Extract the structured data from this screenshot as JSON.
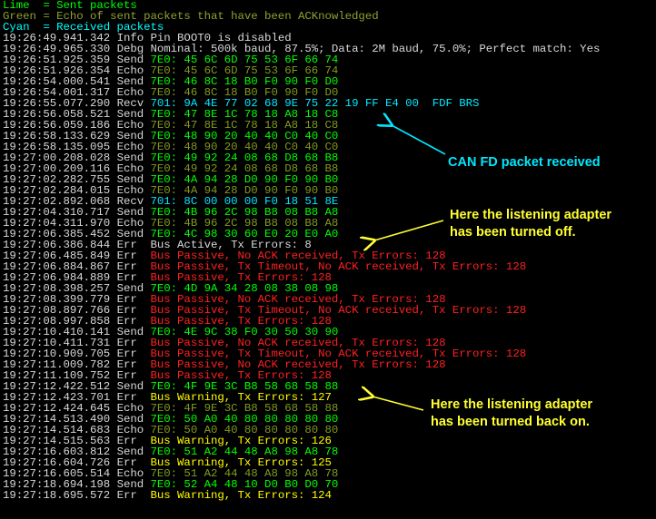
{
  "legend": [
    {
      "text": "Lime  = Sent packets",
      "style": "lime"
    },
    {
      "text": "Green = Echo of sent packets that have been ACKnowledged",
      "style": "green"
    },
    {
      "text": "Cyan  = Received packets",
      "style": "cyan"
    }
  ],
  "log": [
    {
      "time": "19:26:49.941.342",
      "type": "Info",
      "msg": "Pin BOOT0 is disabled",
      "style": "white"
    },
    {
      "time": "19:26:49.965.330",
      "type": "Debg",
      "msg": "Nominal: 500k baud, 87.5%; Data: 2M baud, 75.0%; Perfect match: Yes",
      "style": "white"
    },
    {
      "time": "19:26:51.925.359",
      "type": "Send",
      "msg": "7E0: 45 6C 6D 75 53 6F 66 74",
      "style": "send"
    },
    {
      "time": "19:26:51.926.354",
      "type": "Echo",
      "msg": "7E0: 45 6C 6D 75 53 6F 66 74",
      "style": "echo"
    },
    {
      "time": "19:26:54.000.541",
      "type": "Send",
      "msg": "7E0: 46 8C 18 B0 F0 90 F0 D0",
      "style": "send"
    },
    {
      "time": "19:26:54.001.317",
      "type": "Echo",
      "msg": "7E0: 46 8C 18 B0 F0 90 F0 D0",
      "style": "echo"
    },
    {
      "time": "19:26:55.077.290",
      "type": "Recv",
      "msg": "701: 9A 4E 77 02 68 9E 75 22 19 FF E4 00  FDF BRS",
      "style": "recv"
    },
    {
      "time": "19:26:56.058.521",
      "type": "Send",
      "msg": "7E0: 47 8E 1C 78 18 A8 18 C8",
      "style": "send"
    },
    {
      "time": "19:26:56.059.186",
      "type": "Echo",
      "msg": "7E0: 47 8E 1C 78 18 A8 18 C8",
      "style": "echo"
    },
    {
      "time": "19:26:58.133.629",
      "type": "Send",
      "msg": "7E0: 48 90 20 40 40 C0 40 C0",
      "style": "send"
    },
    {
      "time": "19:26:58.135.095",
      "type": "Echo",
      "msg": "7E0: 48 90 20 40 40 C0 40 C0",
      "style": "echo"
    },
    {
      "time": "19:27:00.208.028",
      "type": "Send",
      "msg": "7E0: 49 92 24 08 68 D8 68 B8",
      "style": "send"
    },
    {
      "time": "19:27:00.209.116",
      "type": "Echo",
      "msg": "7E0: 49 92 24 08 68 D8 68 B8",
      "style": "echo"
    },
    {
      "time": "19:27:02.282.755",
      "type": "Send",
      "msg": "7E0: 4A 94 28 D0 90 F0 90 B0",
      "style": "send"
    },
    {
      "time": "19:27:02.284.015",
      "type": "Echo",
      "msg": "7E0: 4A 94 28 D0 90 F0 90 B0",
      "style": "echo"
    },
    {
      "time": "19:27:02.892.068",
      "type": "Recv",
      "msg": "701: 8C 00 00 00 F0 18 51 8E",
      "style": "recv"
    },
    {
      "time": "19:27:04.310.717",
      "type": "Send",
      "msg": "7E0: 4B 96 2C 98 B8 08 B8 A8",
      "style": "send"
    },
    {
      "time": "19:27:04.311.970",
      "type": "Echo",
      "msg": "7E0: 4B 96 2C 98 B8 08 B8 A8",
      "style": "echo"
    },
    {
      "time": "19:27:06.385.452",
      "type": "Send",
      "msg": "7E0: 4C 98 30 60 E0 20 E0 A0",
      "style": "send"
    },
    {
      "time": "19:27:06.386.844",
      "type": "Err ",
      "msg": "Bus Active, Tx Errors: 8",
      "style": "normal"
    },
    {
      "time": "19:27:06.485.849",
      "type": "Err ",
      "msg": "Bus Passive, No ACK received, Tx Errors: 128",
      "style": "err"
    },
    {
      "time": "19:27:06.884.867",
      "type": "Err ",
      "msg": "Bus Passive, Tx Timeout, No ACK received, Tx Errors: 128",
      "style": "err"
    },
    {
      "time": "19:27:06.984.889",
      "type": "Err ",
      "msg": "Bus Passive, Tx Errors: 128",
      "style": "err"
    },
    {
      "time": "19:27:08.398.257",
      "type": "Send",
      "msg": "7E0: 4D 9A 34 28 08 38 08 98",
      "style": "send"
    },
    {
      "time": "19:27:08.399.779",
      "type": "Err ",
      "msg": "Bus Passive, No ACK received, Tx Errors: 128",
      "style": "err"
    },
    {
      "time": "19:27:08.897.766",
      "type": "Err ",
      "msg": "Bus Passive, Tx Timeout, No ACK received, Tx Errors: 128",
      "style": "err"
    },
    {
      "time": "19:27:08.997.858",
      "type": "Err ",
      "msg": "Bus Passive, Tx Errors: 128",
      "style": "err"
    },
    {
      "time": "19:27:10.410.141",
      "type": "Send",
      "msg": "7E0: 4E 9C 38 F0 30 50 30 90",
      "style": "send"
    },
    {
      "time": "19:27:10.411.731",
      "type": "Err ",
      "msg": "Bus Passive, No ACK received, Tx Errors: 128",
      "style": "err"
    },
    {
      "time": "19:27:10.909.705",
      "type": "Err ",
      "msg": "Bus Passive, Tx Timeout, No ACK received, Tx Errors: 128",
      "style": "err"
    },
    {
      "time": "19:27:11.009.782",
      "type": "Err ",
      "msg": "Bus Passive, No ACK received, Tx Errors: 128",
      "style": "err"
    },
    {
      "time": "19:27:11.109.752",
      "type": "Err ",
      "msg": "Bus Passive, Tx Errors: 128",
      "style": "err"
    },
    {
      "time": "19:27:12.422.512",
      "type": "Send",
      "msg": "7E0: 4F 9E 3C B8 58 68 58 88",
      "style": "send"
    },
    {
      "time": "19:27:12.423.701",
      "type": "Err ",
      "msg": "Bus Warning, Tx Errors: 127",
      "style": "warn"
    },
    {
      "time": "19:27:12.424.645",
      "type": "Echo",
      "msg": "7E0: 4F 9E 3C B8 58 68 58 88",
      "style": "echo"
    },
    {
      "time": "19:27:14.513.490",
      "type": "Send",
      "msg": "7E0: 50 A0 40 80 80 80 80 80",
      "style": "send"
    },
    {
      "time": "19:27:14.514.683",
      "type": "Echo",
      "msg": "7E0: 50 A0 40 80 80 80 80 80",
      "style": "echo"
    },
    {
      "time": "19:27:14.515.563",
      "type": "Err ",
      "msg": "Bus Warning, Tx Errors: 126",
      "style": "warn"
    },
    {
      "time": "19:27:16.603.812",
      "type": "Send",
      "msg": "7E0: 51 A2 44 48 A8 98 A8 78",
      "style": "send"
    },
    {
      "time": "19:27:16.604.726",
      "type": "Err ",
      "msg": "Bus Warning, Tx Errors: 125",
      "style": "warn"
    },
    {
      "time": "19:27:16.605.514",
      "type": "Echo",
      "msg": "7E0: 51 A2 44 48 A8 98 A8 78",
      "style": "echo"
    },
    {
      "time": "19:27:18.694.198",
      "type": "Send",
      "msg": "7E0: 52 A4 48 10 D0 B0 D0 70",
      "style": "send"
    },
    {
      "time": "19:27:18.695.572",
      "type": "Err ",
      "msg": "Bus Warning, Tx Errors: 124",
      "style": "warn"
    }
  ],
  "annotations": {
    "canfd": "CAN FD packet received",
    "off_line1": "Here the listening adapter",
    "off_line2": "has been turned off.",
    "on_line1": "Here the listening adapter",
    "on_line2": "has been turned back on."
  },
  "colors": {
    "background": "#000000",
    "send": "#00ff00",
    "echo": "#809a20",
    "recv": "#00e8ff",
    "err": "#ff2020",
    "warn": "#ffff00",
    "annotation_cyan": "#00e8ff",
    "annotation_yellow": "#ffff30"
  }
}
